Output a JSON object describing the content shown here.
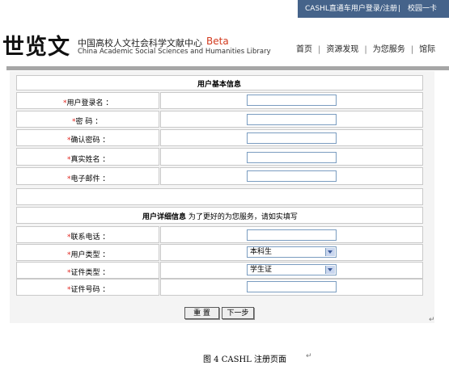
{
  "topbar": {
    "link1": "CASHL直通车用户登录/注册",
    "sep": "|",
    "link2": "校园一卡"
  },
  "header": {
    "logo_glyphs": "世览文",
    "org_cn": "中国高校人文社会科学文献中心",
    "beta": "Beta",
    "org_en": "China Academic Social Sciences and Humanities Library",
    "nav": [
      "首页",
      "资源发现",
      "为您服务",
      "馆际"
    ]
  },
  "form": {
    "basic_title": "用户基本信息",
    "basic_fields": [
      {
        "req": "*",
        "label": "用户登录名 ："
      },
      {
        "req": "*",
        "label": "密  码 ："
      },
      {
        "req": "*",
        "label": "确认密码 ："
      },
      {
        "req": "*",
        "label": "真实姓名 ："
      },
      {
        "req": "*",
        "label": "电子邮件 ："
      }
    ],
    "detail_title": "用户详细信息",
    "detail_subtitle": " 为了更好的为您服务，请如实填写",
    "detail_fields": [
      {
        "req": "*",
        "label": "联系电话 ："
      },
      {
        "req": "*",
        "label": "用户类型 ："
      },
      {
        "req": "*",
        "label": "证件类型 ："
      },
      {
        "req": "*",
        "label": "证件号码 ："
      }
    ],
    "user_type_selected": "本科生",
    "id_type_selected": "学生证",
    "reset_button": "重  置",
    "next_button": "下一步"
  },
  "caption": "图 4 CASHL 注册页面",
  "marks": [
    "↵",
    "↵"
  ]
}
